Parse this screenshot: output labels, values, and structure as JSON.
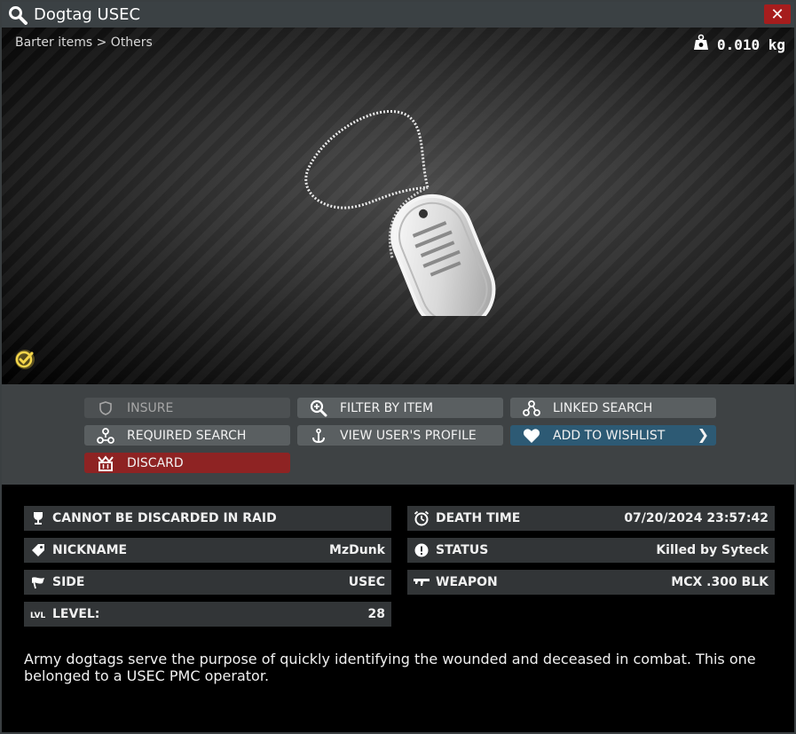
{
  "window": {
    "title": "Dogtag USEC",
    "close_label": "✕"
  },
  "preview": {
    "breadcrumb": "Barter items > Others",
    "weight": "0.010 kg"
  },
  "actions": {
    "insure": "INSURE",
    "filter_by_item": "FILTER BY ITEM",
    "linked_search": "LINKED SEARCH",
    "required_search": "REQUIRED SEARCH",
    "view_profile": "VIEW USER'S PROFILE",
    "add_to_wishlist": "ADD TO WISHLIST",
    "discard": "DISCARD"
  },
  "stats": {
    "no_discard": "CANNOT BE DISCARDED IN RAID",
    "nickname_label": "NICKNAME",
    "nickname_value": "MzDunk",
    "side_label": "SIDE",
    "side_value": "USEC",
    "level_label": "LEVEL:",
    "level_value": "28",
    "death_time_label": "DEATH TIME",
    "death_time_value": "07/20/2024 23:57:42",
    "status_label": "STATUS",
    "status_value": "Killed by Syteck",
    "weapon_label": "WEAPON",
    "weapon_value": "MCX .300 BLK"
  },
  "description": "Army dogtags serve the purpose of quickly identifying the wounded and deceased in combat. This one belonged to a USEC PMC operator.",
  "colors": {
    "accent": "#2d5a74",
    "danger": "#8e2323",
    "close": "#a61d1d",
    "examined": "#e8c940"
  }
}
